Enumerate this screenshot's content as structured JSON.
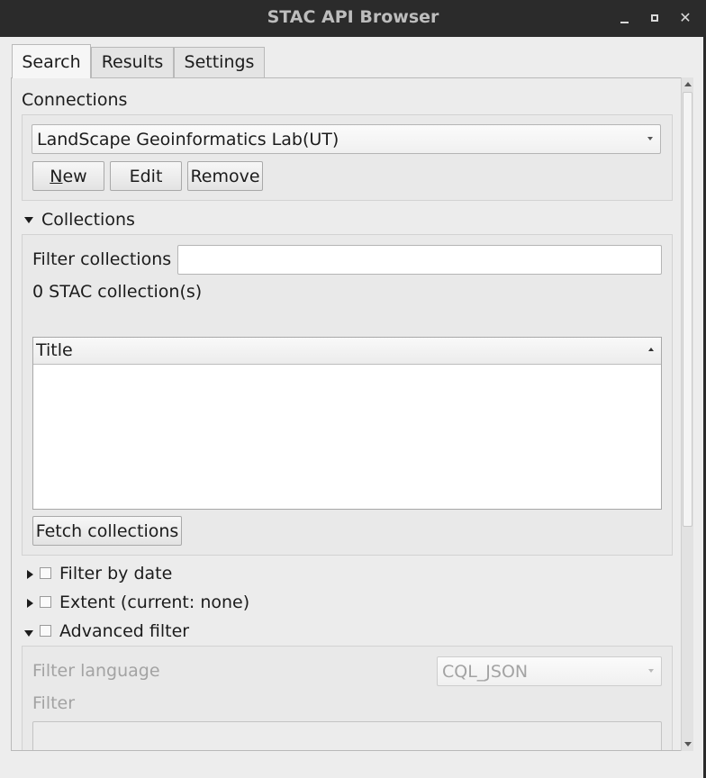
{
  "window": {
    "title": "STAC API Browser"
  },
  "tabs": [
    {
      "label": "Search"
    },
    {
      "label": "Results"
    },
    {
      "label": "Settings"
    }
  ],
  "connections": {
    "label": "Connections",
    "selected": "LandScape Geoinformatics Lab(UT)",
    "new_prefix": "N",
    "new_rest": "ew",
    "edit_label": "Edit",
    "remove_label": "Remove"
  },
  "collections": {
    "label": "Collections",
    "filter_label": "Filter collections",
    "filter_value": "",
    "count_text": "0 STAC collection(s)",
    "column_header": "Title",
    "fetch_label": "Fetch collections"
  },
  "filters": {
    "date_label": "Filter by date",
    "extent_label": "Extent (current: none)",
    "advanced_label": "Advanced filter"
  },
  "advanced": {
    "language_label": "Filter language",
    "language_value": "CQL_JSON",
    "filter_label": "Filter"
  }
}
